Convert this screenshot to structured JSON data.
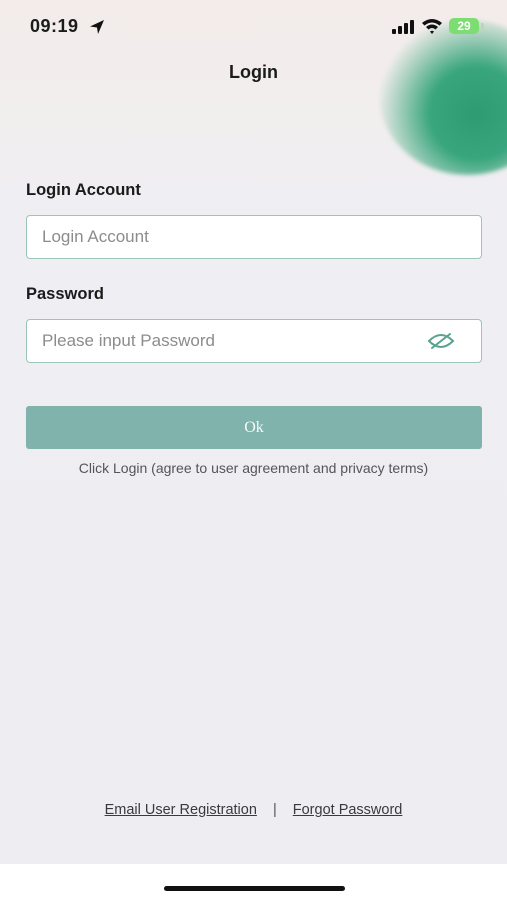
{
  "status_bar": {
    "time": "09:19",
    "battery": "29",
    "icons": [
      "location-arrow-icon",
      "cellular-signal-icon",
      "wifi-icon",
      "battery-icon"
    ]
  },
  "header": {
    "title": "Login"
  },
  "form": {
    "account": {
      "label": "Login Account",
      "placeholder": "Login Account",
      "value": ""
    },
    "password": {
      "label": "Password",
      "placeholder": "Please input Password",
      "value": "",
      "toggle_icon": "eye-hidden-icon"
    },
    "submit_label": "Ok",
    "terms_text": "Click Login (agree to user agreement and privacy terms)"
  },
  "footer": {
    "register_link": "Email User Registration",
    "separator": "|",
    "forgot_link": "Forgot Password"
  },
  "colors": {
    "accent": "#7fb3ab",
    "field_border": "#9cc4b8",
    "background": "#efeef2",
    "battery_green": "#7ddc72"
  }
}
